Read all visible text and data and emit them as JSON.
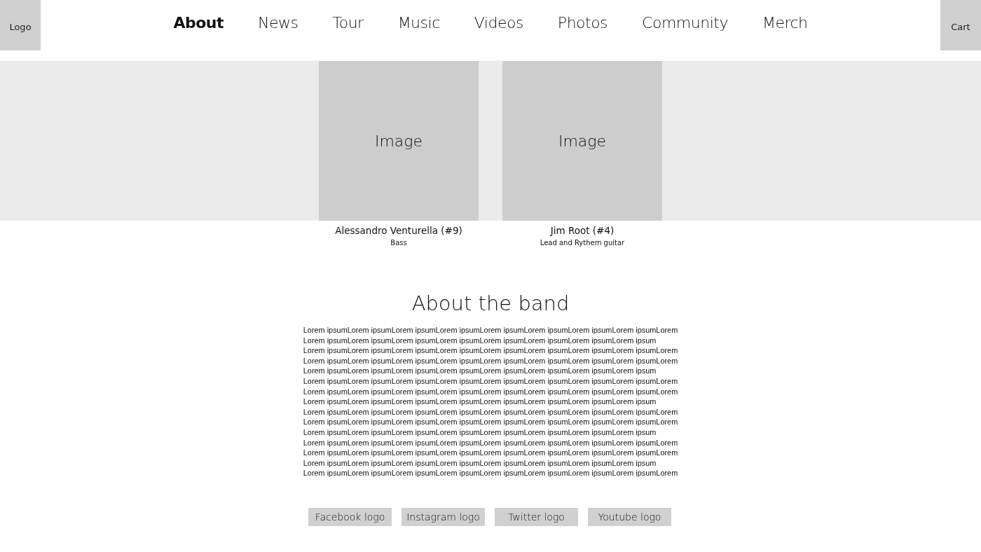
{
  "header": {
    "logo": "Logo",
    "cart": "Cart"
  },
  "nav": [
    {
      "label": "About",
      "selected": true
    },
    {
      "label": "News",
      "selected": false
    },
    {
      "label": "Tour",
      "selected": false
    },
    {
      "label": "Music",
      "selected": false
    },
    {
      "label": "Videos",
      "selected": false
    },
    {
      "label": "Photos",
      "selected": false
    },
    {
      "label": "Community",
      "selected": false
    },
    {
      "label": "Merch",
      "selected": false
    }
  ],
  "members": [
    {
      "image": "Image",
      "name": "Alessandro Venturella (#9)",
      "role": "Bass"
    },
    {
      "image": "Image",
      "name": "Jim Root (#4)",
      "role": "Lead and Rythem guitar"
    }
  ],
  "about": {
    "heading": "About the band",
    "lines": [
      "Lorem ipsumLorem ipsumLorem ipsumLorem ipsumLorem ipsumLorem ipsumLorem ipsumLorem ipsumLorem",
      "Lorem ipsumLorem ipsumLorem ipsumLorem ipsumLorem ipsumLorem ipsumLorem ipsumLorem ipsum",
      "Lorem ipsumLorem ipsumLorem ipsumLorem ipsumLorem ipsumLorem ipsumLorem ipsumLorem ipsumLorem",
      "Lorem ipsumLorem ipsumLorem ipsumLorem ipsumLorem ipsumLorem ipsumLorem ipsumLorem ipsumLorem",
      "Lorem ipsumLorem ipsumLorem ipsumLorem ipsumLorem ipsumLorem ipsumLorem ipsumLorem ipsum",
      "Lorem ipsumLorem ipsumLorem ipsumLorem ipsumLorem ipsumLorem ipsumLorem ipsumLorem ipsumLorem",
      "Lorem ipsumLorem ipsumLorem ipsumLorem ipsumLorem ipsumLorem ipsumLorem ipsumLorem ipsumLorem",
      "Lorem ipsumLorem ipsumLorem ipsumLorem ipsumLorem ipsumLorem ipsumLorem ipsumLorem ipsum",
      "Lorem ipsumLorem ipsumLorem ipsumLorem ipsumLorem ipsumLorem ipsumLorem ipsumLorem ipsumLorem",
      "Lorem ipsumLorem ipsumLorem ipsumLorem ipsumLorem ipsumLorem ipsumLorem ipsumLorem ipsumLorem",
      "Lorem ipsumLorem ipsumLorem ipsumLorem ipsumLorem ipsumLorem ipsumLorem ipsumLorem ipsum",
      "Lorem ipsumLorem ipsumLorem ipsumLorem ipsumLorem ipsumLorem ipsumLorem ipsumLorem ipsumLorem",
      "Lorem ipsumLorem ipsumLorem ipsumLorem ipsumLorem ipsumLorem ipsumLorem ipsumLorem ipsumLorem",
      "Lorem ipsumLorem ipsumLorem ipsumLorem ipsumLorem ipsumLorem ipsumLorem ipsumLorem ipsum",
      "Lorem ipsumLorem ipsumLorem ipsumLorem ipsumLorem ipsumLorem ipsumLorem ipsumLorem ipsumLorem"
    ]
  },
  "social": [
    "Facebook logo",
    "Instagram logo",
    "Twitter logo",
    "Youtube logo"
  ]
}
